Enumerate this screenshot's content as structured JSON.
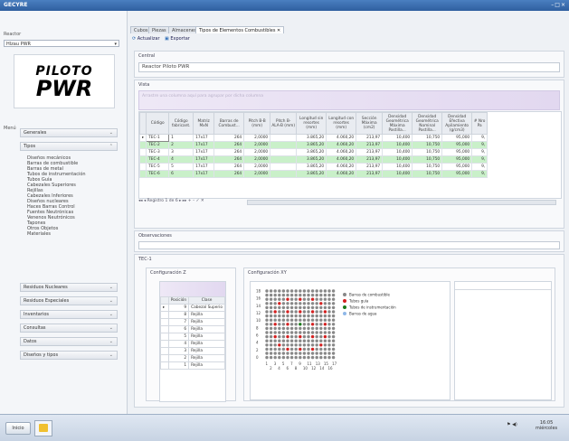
{
  "window": {
    "title": "GECYRE",
    "controls": "–□×"
  },
  "left": {
    "reactor_label": "Reactor",
    "reactor_value": "Hlzau PWR",
    "logo_line1": "PILOTO",
    "logo_line2": "PWR",
    "menu_label": "Menú",
    "sections": [
      {
        "label": "Generales"
      },
      {
        "label": "Tipos"
      },
      {
        "label": "Residuos Nucleares"
      },
      {
        "label": "Residuos Especiales"
      },
      {
        "label": "Inventarios"
      },
      {
        "label": "Consultas"
      },
      {
        "label": "Datos"
      },
      {
        "label": "Diseños y tipos"
      }
    ],
    "tipos_items": [
      "Diseños mecánicos",
      "Barras de combustible",
      "Barras de metal",
      "Tubos de instrumentación",
      "Tubos Guía",
      "Cabezales Superiores",
      "Rejillas",
      "Cabezales Inferiores",
      "Diseños nucleares",
      "Haces Barras Control",
      "Fuentes Neutrónicas",
      "Venenos Neutrónicos",
      "Tapones",
      "Otros Objetos",
      "Materiales"
    ]
  },
  "main": {
    "tabs": [
      "Cubos",
      "Piezas",
      "Almacenes",
      "Tipos de Elementos Combustibles ✕"
    ],
    "toolbar": {
      "refresh": "Actualizar",
      "export": "Exportar"
    },
    "central_label": "Central",
    "central_value": "Reactor Piloto PWR",
    "grid_label": "Vista",
    "grid_hint": "Arrastre una columna aquí para agrupar por dicha columna",
    "columns": [
      "Código",
      "Código fabricant.",
      "Matriz MxN",
      "Barras de Combust...",
      "Pitch B-B (mm)",
      "Pitch B-ALA-B (mm)",
      "Longitud sin resortes (mm)",
      "Longitud con resortes (mm)",
      "Sección Máxima (cm2)",
      "Densidad Geométrica Máxima Pastilla...",
      "Densidad Geométrica Nominal Pastilla...",
      "Densidad Efectiva Apilamiento (g/cm3)",
      "# Nro Pa"
    ],
    "rows": [
      {
        "style": "w",
        "cells": [
          "TEC-1",
          "1",
          "17x17",
          "264",
          "2,0000",
          "",
          "3.865,20",
          "4.060,20",
          "213,97",
          "10,400",
          "10,750",
          "95,000",
          "9,"
        ]
      },
      {
        "style": "g",
        "cells": [
          "TEC-2",
          "2",
          "17x17",
          "264",
          "2,0000",
          "",
          "3.865,20",
          "4.060,20",
          "213,97",
          "10,400",
          "10,750",
          "95,000",
          "9,"
        ]
      },
      {
        "style": "w",
        "cells": [
          "TEC-3",
          "3",
          "17x17",
          "264",
          "2,0000",
          "",
          "3.865,20",
          "4.060,20",
          "213,97",
          "10,400",
          "10,750",
          "95,000",
          "9,"
        ]
      },
      {
        "style": "g",
        "cells": [
          "TEC-4",
          "4",
          "17x17",
          "264",
          "2,0000",
          "",
          "3.865,20",
          "4.060,20",
          "213,97",
          "10,400",
          "10,750",
          "95,000",
          "9,"
        ]
      },
      {
        "style": "w",
        "cells": [
          "TEC-5",
          "5",
          "17x17",
          "264",
          "2,0000",
          "",
          "3.865,20",
          "4.060,20",
          "213,97",
          "10,400",
          "10,750",
          "95,000",
          "9,"
        ]
      },
      {
        "style": "g",
        "cells": [
          "TEC-6",
          "6",
          "17x17",
          "264",
          "2,0000",
          "",
          "3.865,20",
          "4.060,20",
          "213,97",
          "10,400",
          "10,750",
          "95,000",
          "9,"
        ]
      }
    ],
    "pager": "◂◂ ◂ Registro 1 de 6 ▸ ▸▸ + – ✓ ✕",
    "obs_label": "Observaciones",
    "detail_label": "TEC-1",
    "config_z_label": "Configuración Z",
    "config_xy_label": "Configuración XY",
    "z_table": {
      "headers": [
        "Posición",
        "Clase"
      ],
      "rows": [
        [
          "9",
          "Cabezal Superio"
        ],
        [
          "8",
          "Rejilla"
        ],
        [
          "7",
          "Rejilla"
        ],
        [
          "6",
          "Rejilla"
        ],
        [
          "5",
          "Rejilla"
        ],
        [
          "4",
          "Rejilla"
        ],
        [
          "3",
          "Rejilla"
        ],
        [
          "2",
          "Rejilla"
        ],
        [
          "1",
          "Rejilla"
        ]
      ]
    },
    "xy_legend": [
      {
        "label": "Barras de combustible",
        "color": "#888888"
      },
      {
        "label": "Tubos guía",
        "color": "#d42020"
      },
      {
        "label": "Tubos de instrumentación",
        "color": "#1a7a1a"
      },
      {
        "label": "Barras de agua",
        "color": "#8fb8e8"
      }
    ],
    "xy_axis_x": [
      "1",
      "2",
      "3",
      "4",
      "5",
      "6",
      "7",
      "8",
      "9",
      "10",
      "11",
      "12",
      "13",
      "14",
      "15",
      "16",
      "17"
    ],
    "xy_axis_y": [
      "18",
      "16",
      "14",
      "12",
      "10",
      "8",
      "6",
      "4",
      "2",
      "0"
    ]
  },
  "taskbar": {
    "start": "Inicio",
    "time": "16:05",
    "date": "miércoles"
  }
}
